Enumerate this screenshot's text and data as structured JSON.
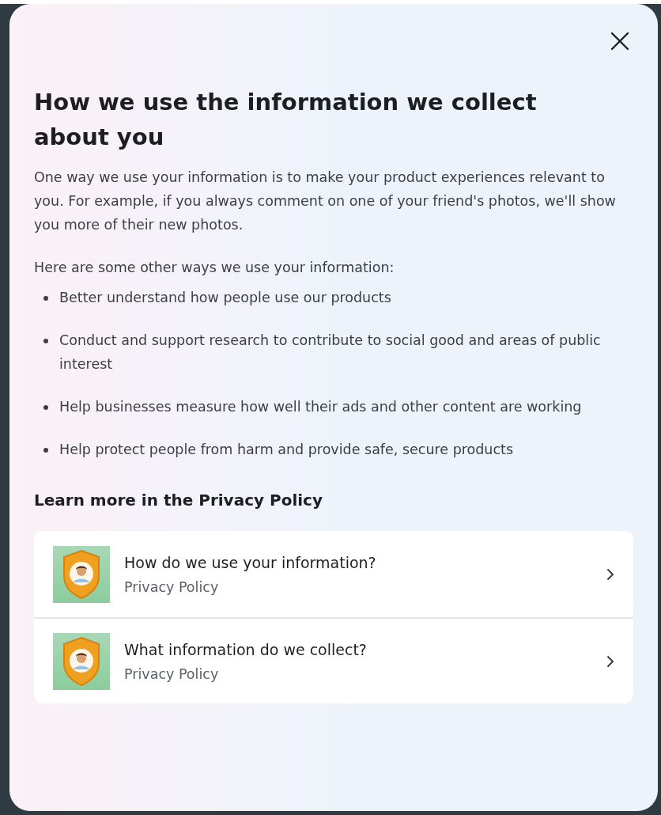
{
  "dialog": {
    "title": "How we use the information we collect about you",
    "intro": "One way we use your information is to make your product experiences relevant to you. For example, if you always comment on one of your friend's photos, we'll show you more of their new photos.",
    "list_heading": "Here are some other ways we use your information:",
    "bullets": [
      "Better understand how people use our products",
      "Conduct and support research to contribute to social good and areas of public interest",
      "Help businesses measure how well their ads and other content are working",
      "Help protect people from harm and provide safe, secure products"
    ],
    "learn_more_heading": "Learn more in the Privacy Policy",
    "links": [
      {
        "title": "How do we use your information?",
        "subtitle": "Privacy Policy"
      },
      {
        "title": "What information do we collect?",
        "subtitle": "Privacy Policy"
      }
    ]
  }
}
